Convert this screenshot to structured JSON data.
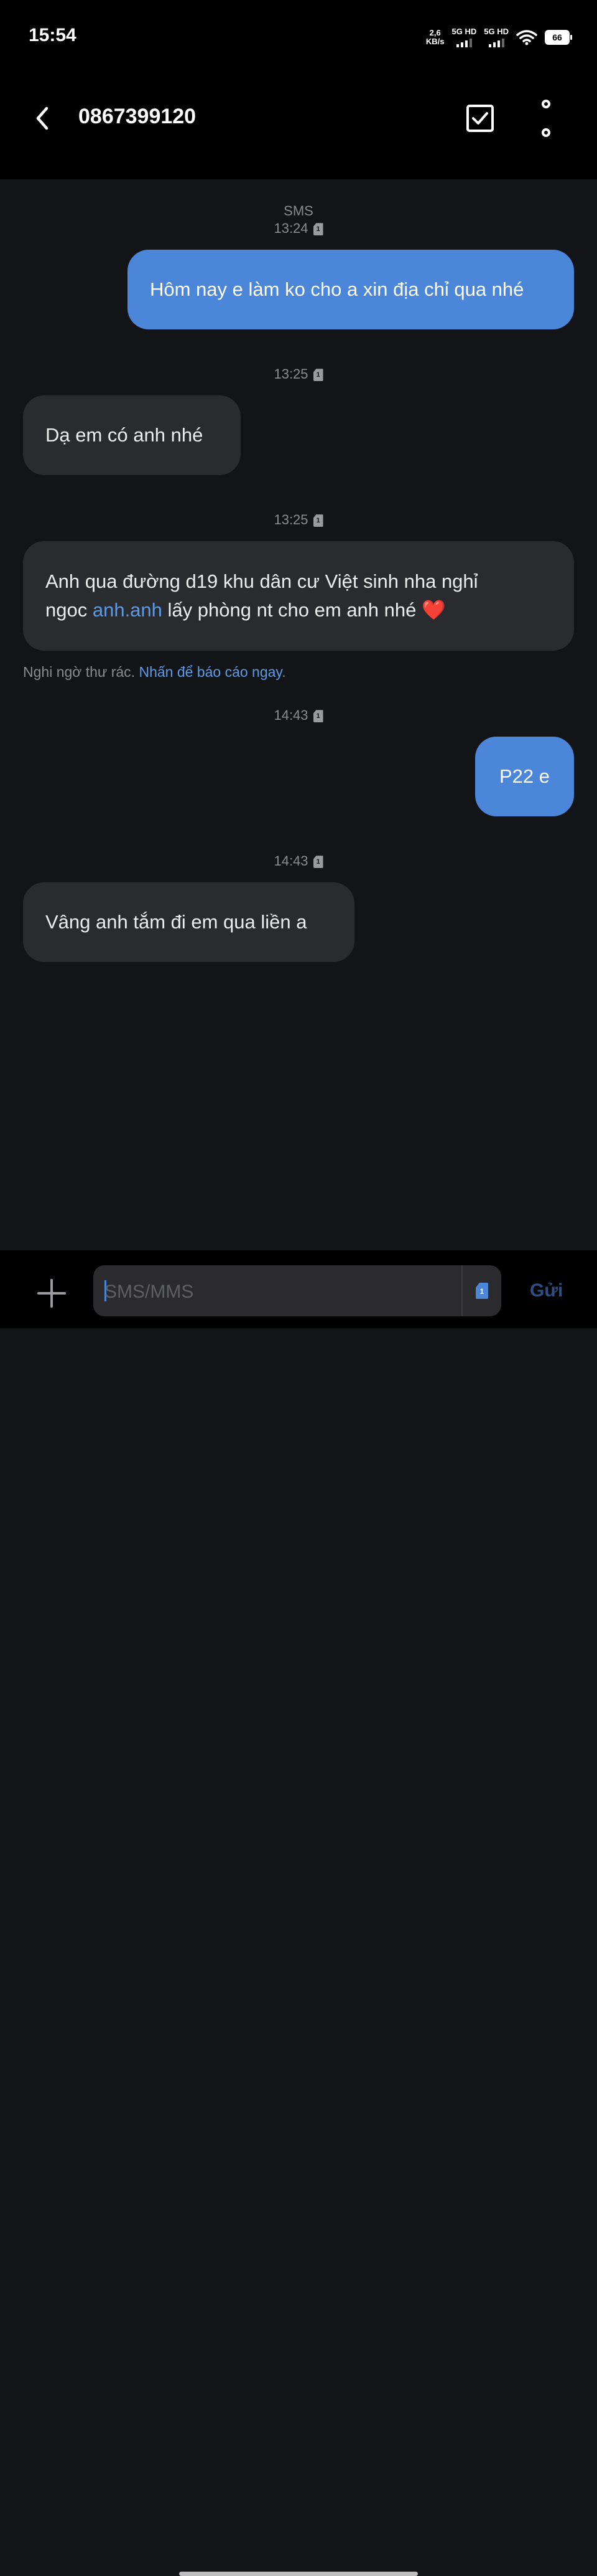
{
  "status_bar": {
    "time": "15:54",
    "net_speed_value": "2,6",
    "net_speed_unit": "KB/s",
    "sim1_label": "5G HD",
    "sim2_label": "5G HD",
    "battery": "66"
  },
  "header": {
    "contact": "0867399120"
  },
  "conversation": {
    "type_label": "SMS",
    "messages": [
      {
        "time": "13:24",
        "direction": "out",
        "text": "Hôm nay e làm ko cho a xin địa chỉ qua nhé"
      },
      {
        "time": "13:25",
        "direction": "in",
        "text": "Dạ em có anh nhé"
      },
      {
        "time": "13:25",
        "direction": "in",
        "text_line1": "Anh qua đường d19 khu dân cư Việt sinh nha nghỉ",
        "text_line2_before": "ngoc ",
        "link": "anh.anh",
        "text_line2_after": " lấy phòng nt cho em anh nhé ❤️"
      },
      {
        "time": "14:43",
        "direction": "out",
        "text": "P22 e"
      },
      {
        "time": "14:43",
        "direction": "in",
        "text": "Vâng anh tắm đi em qua liền a"
      }
    ],
    "sim_badge": "1",
    "spam_notice": {
      "text": "Nghi ngờ thư rác. ",
      "action": "Nhấn để báo cáo ngay",
      "suffix": "."
    }
  },
  "composer": {
    "placeholder": "SMS/MMS",
    "sim_badge": "1",
    "send_label": "Gửi"
  },
  "colors": {
    "outgoing_bubble": "#4b86d8",
    "incoming_bubble": "#2a2b2e",
    "background": "#131417",
    "link": "#5b9be6"
  },
  "icons": [
    "back-arrow-icon",
    "select-checkbox-icon",
    "more-options-icon",
    "sim-card-icon",
    "add-icon",
    "wifi-icon",
    "battery-icon"
  ]
}
